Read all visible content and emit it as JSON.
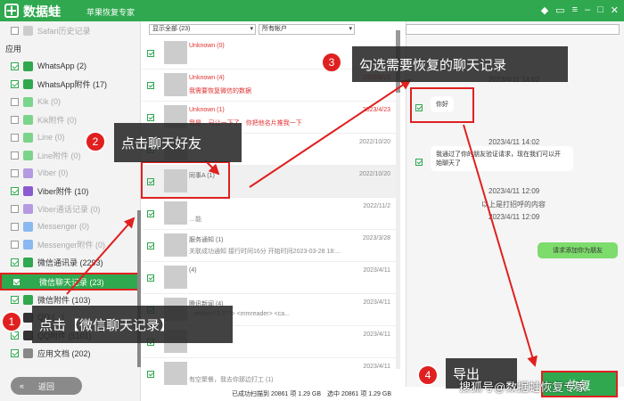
{
  "titlebar": {
    "app_name": "数据蛙",
    "app_subtitle": "苹果恢复专家",
    "icons": [
      "diamond-icon",
      "chat-icon",
      "menu-icon",
      "minimize-icon",
      "maximize-icon",
      "close-icon"
    ]
  },
  "sidebar": {
    "top_item": "Safari历史记录",
    "section": "应用",
    "items": [
      {
        "label": "WhatsApp (2)",
        "checked": true,
        "dim": false,
        "color": "#2fa84f"
      },
      {
        "label": "WhatsApp附件 (17)",
        "checked": true,
        "dim": false,
        "color": "#2fa84f"
      },
      {
        "label": "Kik (0)",
        "checked": false,
        "dim": true,
        "color": "#7bd48b"
      },
      {
        "label": "Kik附件 (0)",
        "checked": false,
        "dim": true,
        "color": "#7bd48b"
      },
      {
        "label": "Line (0)",
        "checked": false,
        "dim": true,
        "color": "#7bd48b"
      },
      {
        "label": "Line附件 (0)",
        "checked": false,
        "dim": true,
        "color": "#7bd48b"
      },
      {
        "label": "Viber (0)",
        "checked": false,
        "dim": true,
        "color": "#b59ae0"
      },
      {
        "label": "Viber附件 (10)",
        "checked": true,
        "dim": false,
        "color": "#8a5bd0"
      },
      {
        "label": "Viber通话记录 (0)",
        "checked": false,
        "dim": true,
        "color": "#b59ae0"
      },
      {
        "label": "Messenger (0)",
        "checked": false,
        "dim": true,
        "color": "#8ab8f0"
      },
      {
        "label": "Messenger附件 (0)",
        "checked": false,
        "dim": true,
        "color": "#8ab8f0"
      },
      {
        "label": "微信通讯录 (2293)",
        "checked": true,
        "dim": false,
        "color": "#2fa84f"
      },
      {
        "label": "微信聊天记录 (23)",
        "checked": true,
        "dim": false,
        "color": "#2fa84f",
        "selected": true
      },
      {
        "label": "微信附件 (103)",
        "checked": true,
        "dim": false,
        "color": "#2fa84f"
      },
      {
        "label": "QQ (...)",
        "checked": true,
        "dim": false,
        "color": "#333333"
      },
      {
        "label": "QQ附件 (5101)",
        "checked": true,
        "dim": false,
        "color": "#333333"
      },
      {
        "label": "应用文档 (202)",
        "checked": true,
        "dim": false,
        "color": "#888888"
      }
    ],
    "back_label": "返回"
  },
  "list": {
    "filter_show": "显示全部 (23)",
    "filter_account": "所有帐户",
    "rows": [
      {
        "name": "Unknown (0)",
        "sub": "",
        "date": "",
        "red": true
      },
      {
        "name": "Unknown (4)",
        "sub": "我需要恢复微信的数据",
        "date": "2022/9/23",
        "red": true
      },
      {
        "name": "Unknown (1)",
        "sub": "我是 .. 已让一下了，你把他名片推我一下",
        "date": "2023/4/23",
        "red": true
      },
      {
        "name": "",
        "sub": "",
        "date": "2022/10/20",
        "red": false
      },
      {
        "name": "同事A (1)",
        "sub": "",
        "date": "2022/10/20",
        "red": false
      },
      {
        "name": "",
        "sub": "…能",
        "date": "2022/11/2",
        "red": false
      },
      {
        "name": "服务通知 (1)",
        "sub": "关联成功通知 接行时间16分 开始时间2023-03-28 18:...",
        "date": "2023/3/28",
        "red": false
      },
      {
        "name": "(4)",
        "sub": "",
        "date": "2023/4/11",
        "red": false
      },
      {
        "name": "腾讯新闻 (4)",
        "sub": "...ersion=\"1.0\"?> <mmreader>   <ca...",
        "date": "2023/4/11",
        "red": false
      },
      {
        "name": "",
        "sub": "",
        "date": "2023/4/11",
        "red": false
      },
      {
        "name": "",
        "sub": "有空聚餐，我去你那边打工 (1)",
        "date": "2023/4/11",
        "red": false
      }
    ]
  },
  "chat": {
    "timestamps": [
      "2023/4/11 14:02",
      "2023/4/11 14:02",
      "2023/4/11 12:09",
      "2023/4/11 12:09"
    ],
    "msg1": "你好",
    "msg2_line1": "我通过了你的朋友验证请求，现在我们可以开",
    "msg2_line2": "始聊天了",
    "msg3": "以上是打招呼的内容",
    "msg4": "请求添加你为朋友"
  },
  "status": {
    "found": "已成功扫描到 20861 项 1.29 GB",
    "selected": "选中 20861 项 1.29 GB"
  },
  "recover_label": "恢复",
  "watermark": "搜狐号@数据蛙恢复专家",
  "callouts": {
    "step1": {
      "num": "1",
      "text": "点击【微信聊天记录】"
    },
    "step2": {
      "num": "2",
      "text": "点击聊天好友"
    },
    "step3": {
      "num": "3",
      "text": "勾选需要恢复的聊天记录"
    },
    "step4": {
      "num": "4",
      "text": "导出"
    }
  }
}
